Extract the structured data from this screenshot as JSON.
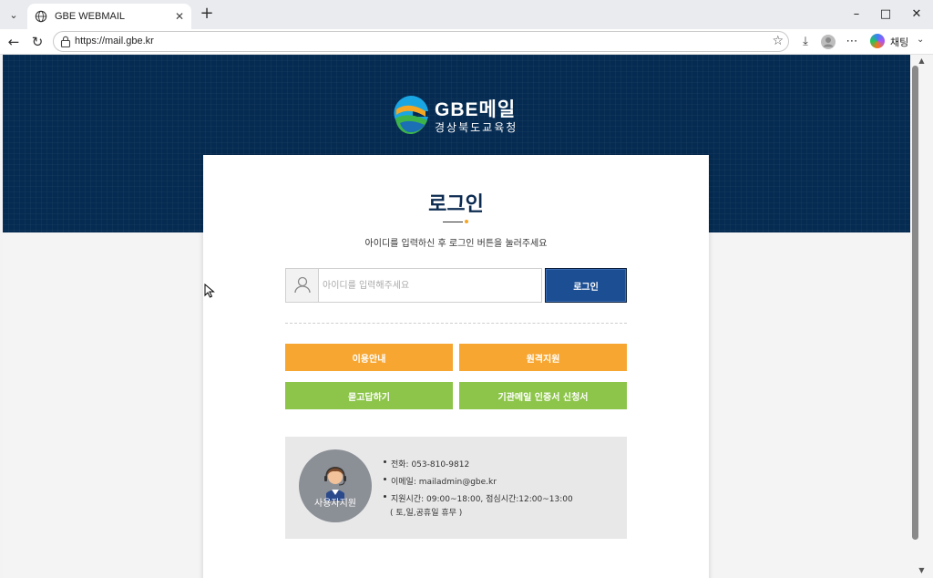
{
  "browser": {
    "tab_title": "GBE WEBMAIL",
    "url": "https://mail.gbe.kr",
    "chat_label": "채팅"
  },
  "header": {
    "brand": "GBE메일",
    "subtitle": "경상북도교육청"
  },
  "login": {
    "title": "로그인",
    "description": "아이디를 입력하신 후 로그인 버튼을 눌러주세요",
    "id_value": "",
    "id_placeholder": "아이디를 입력해주세요",
    "login_label": "로그인"
  },
  "actions": {
    "usage_guide": "이용안내",
    "remote_support": "원격지원",
    "faq": "묻고답하기",
    "cert_request": "기관메일 인증서 신청서"
  },
  "support": {
    "label": "사용자지원",
    "phone": "전화: 053-810-9812",
    "email": "이메일: mailadmin@gbe.kr",
    "hours": "지원시간: 09:00~18:00, 점심시간:12:00~13:00",
    "hours_note": "( 토,일,공휴일 휴무 )"
  },
  "colors": {
    "banner": "#052b52",
    "login_button": "#1c4e93",
    "orange": "#f7a631",
    "green": "#8cc54a"
  }
}
